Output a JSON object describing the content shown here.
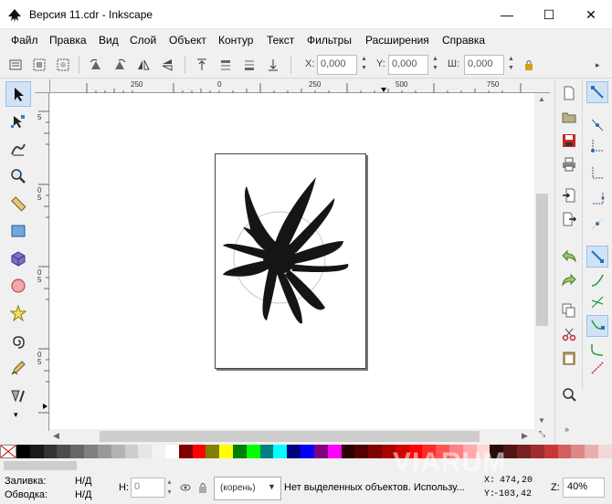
{
  "window": {
    "title": "Версия 11.cdr - Inkscape",
    "minimize": "—",
    "maximize": "☐",
    "close": "✕"
  },
  "menu": [
    "Файл",
    "Правка",
    "Вид",
    "Слой",
    "Объект",
    "Контур",
    "Текст",
    "Фильтры",
    "Расширения",
    "Справка"
  ],
  "toolbar": {
    "x_label": "X:",
    "x_value": "0,000",
    "y_label": "Y:",
    "y_value": "0,000",
    "w_label": "Ш:",
    "w_value": "0,000"
  },
  "ruler": {
    "h_ticks": [
      "250",
      "0",
      "250",
      "500",
      "750"
    ],
    "v_ticks": [
      "5",
      "0",
      "5",
      "0",
      "5",
      "0",
      "5"
    ]
  },
  "palette": [
    "#ffffff",
    "#000000",
    "#1a1a1a",
    "#333333",
    "#4d4d4d",
    "#666666",
    "#808080",
    "#999999",
    "#b3b3b3",
    "#cccccc",
    "#e6e6e6",
    "#f2f2f2",
    "#ffffff",
    "#800000",
    "#ff0000",
    "#808000",
    "#ffff00",
    "#008000",
    "#00ff00",
    "#008080",
    "#00ffff",
    "#000080",
    "#0000ff",
    "#800080",
    "#ff00ff",
    "#2b0000",
    "#550000",
    "#800000",
    "#aa0000",
    "#d40000",
    "#ff0000",
    "#ff2a2a",
    "#ff5555",
    "#ff8080",
    "#ffaaaa",
    "#ffd5d5",
    "#280b0b",
    "#501616",
    "#782121",
    "#a02c2c",
    "#c83737",
    "#d35f5f",
    "#de8787",
    "#e9afaf",
    "#f4d7d7"
  ],
  "status": {
    "fill_label": "Заливка:",
    "fill_value": "Н/Д",
    "stroke_label": "Обводка:",
    "stroke_value": "Н/Д",
    "h_label": "Н:",
    "h_value": "0",
    "layer": "(корень)",
    "message": "Нет выделенных объектов. Использу...",
    "x_coord_label": "X:",
    "x_coord": "474,20",
    "y_coord_label": "Y:",
    "y_coord": "-103,42",
    "zoom_label": "Z:",
    "zoom": "40%"
  },
  "watermark": "VIARUM"
}
